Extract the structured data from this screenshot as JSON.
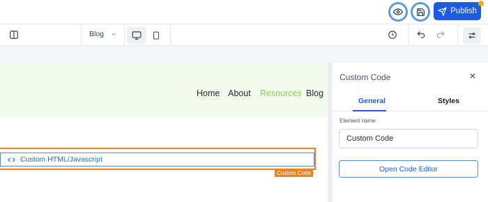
{
  "topbar": {
    "preview_icon": "eye-icon",
    "save_icon": "save-icon",
    "publish_label": "Publish",
    "publish_icon": "send-icon",
    "accent": "#1d5ce0"
  },
  "toolbar": {
    "layout_icon": "panel-toggle-icon",
    "page_select": "Blog",
    "devices": [
      {
        "name": "desktop",
        "icon": "desktop-icon",
        "active": true
      },
      {
        "name": "mobile",
        "icon": "mobile-icon",
        "active": false
      }
    ],
    "history_icon": "history-icon",
    "undo_icon": "undo-icon",
    "redo_icon": "redo-icon",
    "settings_icon": "sliders-icon"
  },
  "site": {
    "nav": [
      "Home",
      "About",
      "Resources",
      "Blog"
    ],
    "nav_link_color": "#8ccc58",
    "element_label": "Custom HTML/Javascript",
    "element_tag": "Custom Code"
  },
  "panel": {
    "title": "Custom Code",
    "tabs": [
      "General",
      "Styles"
    ],
    "active_tab": "General",
    "field_label": "Element name",
    "field_value": "Custom Code",
    "button_label": "Open Code Editor"
  }
}
